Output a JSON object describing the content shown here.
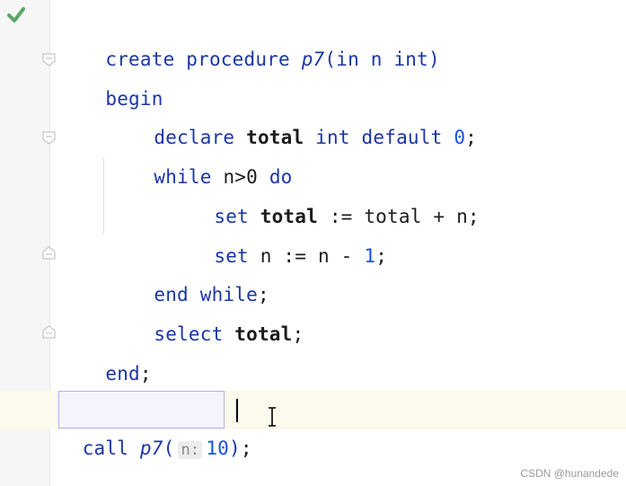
{
  "editor": {
    "lines": {
      "l1": {
        "kw1": "create procedure ",
        "fn": "p7",
        "rest": "(in n int)"
      },
      "l2": {
        "kw": "begin"
      },
      "l3": {
        "kw": "declare ",
        "var": "total ",
        "kw2": "int default ",
        "num": "0",
        "end": ";"
      },
      "l4": {
        "kw": "while ",
        "mid": "n>0 ",
        "kw2": "do"
      },
      "l5": {
        "kw": "set ",
        "var": "total ",
        "mid": ":= total + n;"
      },
      "l6": {
        "kw": "set ",
        "mid": "n := n - ",
        "num": "1",
        "end": ";"
      },
      "l7": {
        "kw": "end while",
        "end": ";"
      },
      "l8": {
        "kw": "select ",
        "var": "total",
        "end": ";"
      },
      "l9": {
        "kw": "end",
        "end": ";"
      }
    },
    "call_line": {
      "kw": "call ",
      "fn": "p7",
      "open": "(",
      "hint": "n:",
      "num": "10",
      "close": ")",
      "end": ";"
    }
  },
  "icons": {
    "status": "checkmark-icon",
    "fold": "fold-marker-icon"
  },
  "colors": {
    "keyword": "#1b35a6",
    "number": "#1750eb",
    "check": "#59a869",
    "current_line": "#fcfaed"
  },
  "watermark": "CSDN @hunandede"
}
